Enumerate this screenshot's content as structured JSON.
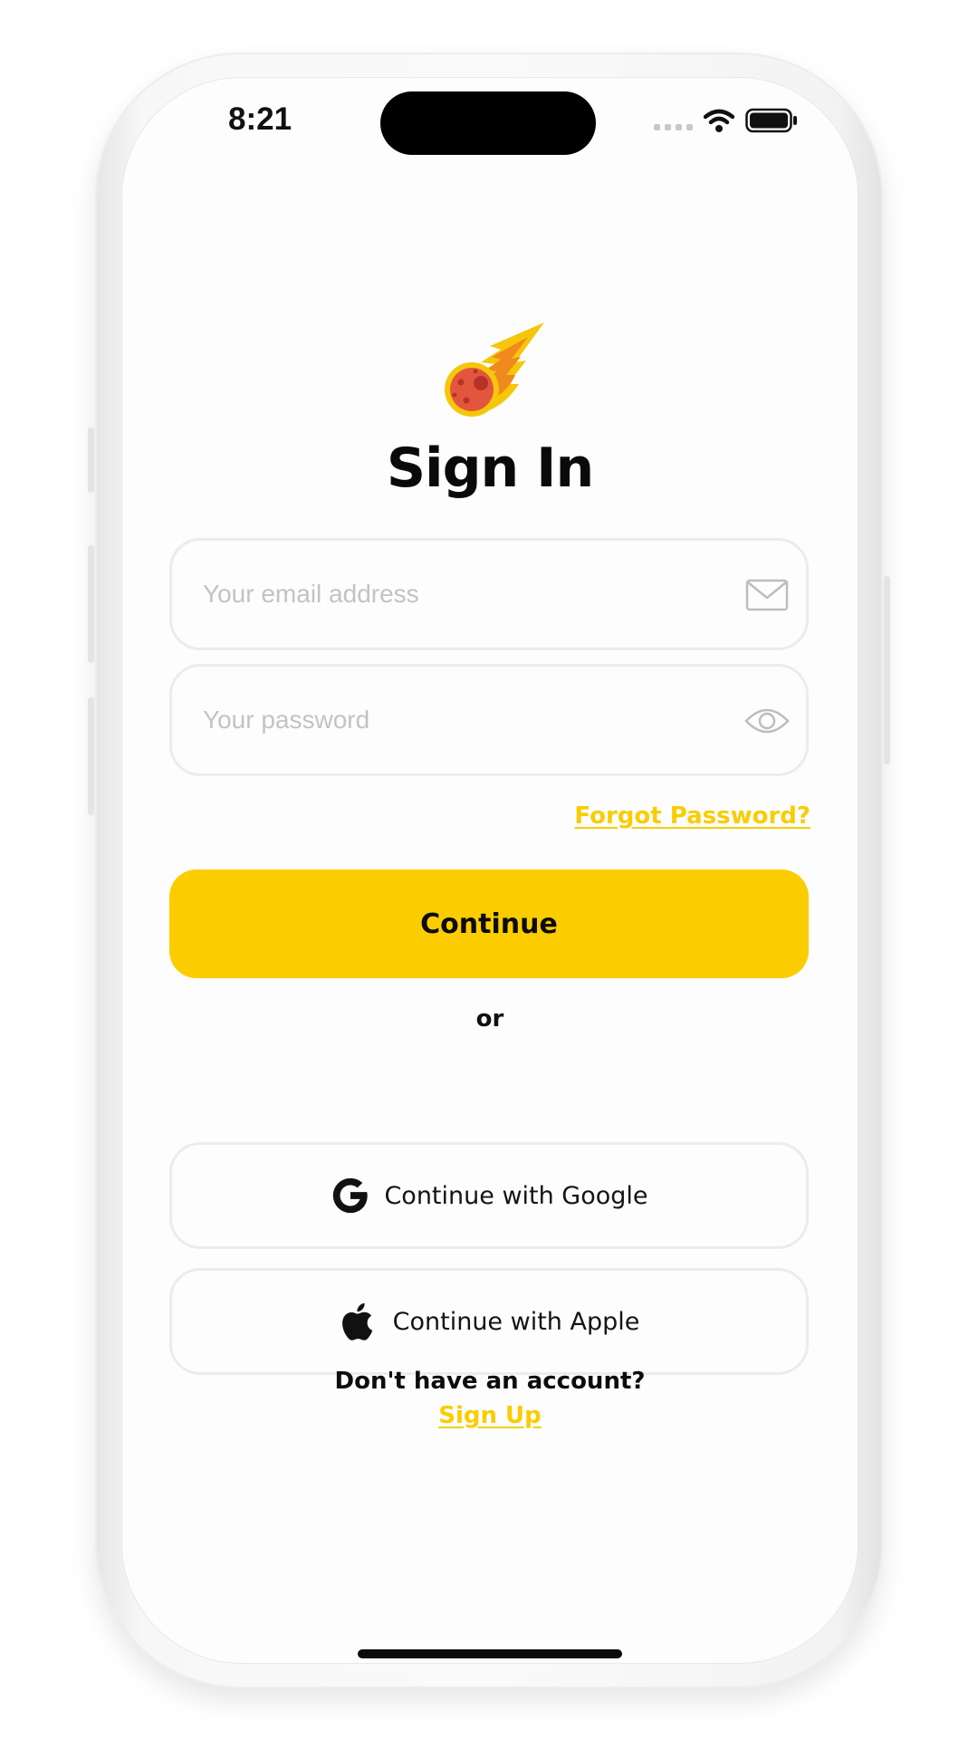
{
  "status_bar": {
    "time": "8:21"
  },
  "brand": {
    "logo_icon": "meteor-icon",
    "accent_color": "#fbcd01"
  },
  "sign_in": {
    "title": "Sign In",
    "email": {
      "placeholder": "Your email address",
      "value": "",
      "icon": "envelope-icon"
    },
    "password": {
      "placeholder": "Your password",
      "value": "",
      "icon": "eye-icon"
    },
    "forgot_label": "Forgot Password?",
    "continue_label": "Continue",
    "or_label": "or",
    "google_label": "Continue with Google",
    "apple_label": "Continue with Apple",
    "no_account_text": "Don't have an account?",
    "signup_label": "Sign Up"
  }
}
